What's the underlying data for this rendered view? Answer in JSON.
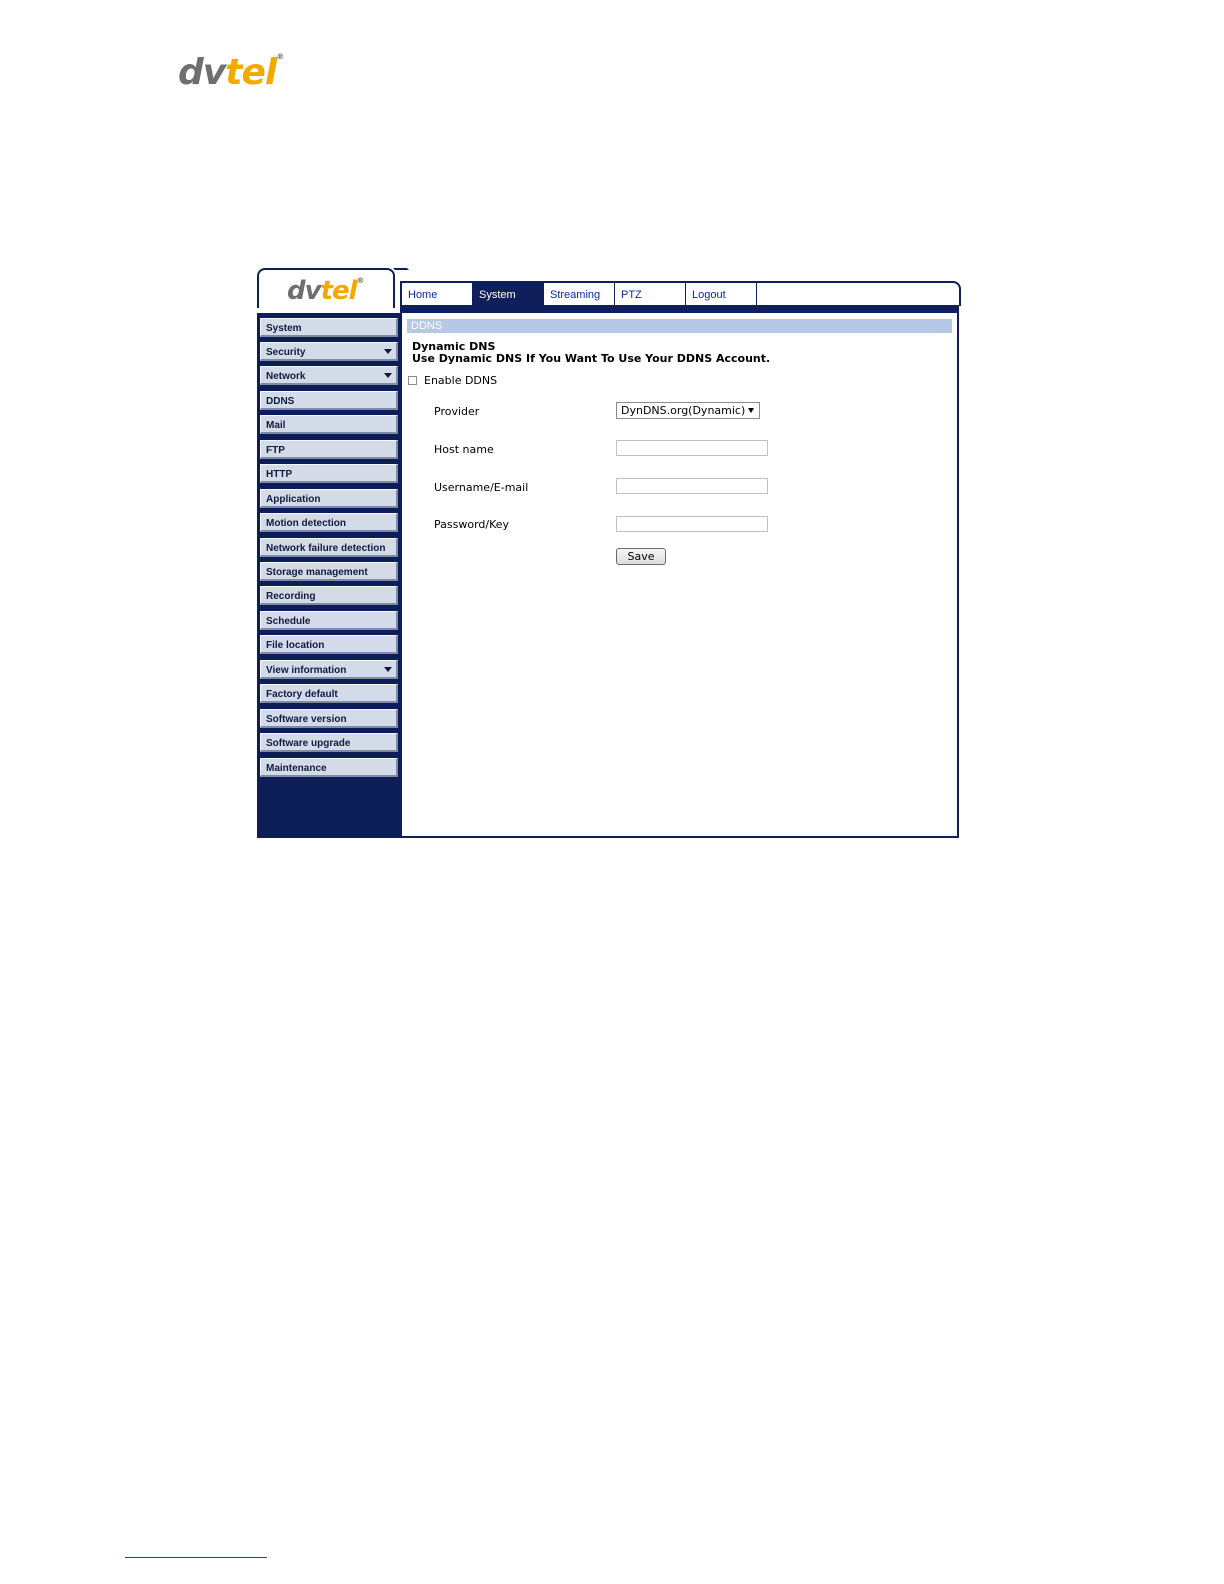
{
  "brand": {
    "logo_dv": "dv",
    "logo_tel": "tel",
    "logo_mark": "®"
  },
  "nav": {
    "tabs": [
      {
        "label": "Home"
      },
      {
        "label": "System"
      },
      {
        "label": "Streaming"
      },
      {
        "label": "PTZ"
      },
      {
        "label": "Logout"
      }
    ],
    "active": "System"
  },
  "sidebar": {
    "items": [
      {
        "label": "System",
        "has_submenu": false
      },
      {
        "label": "Security",
        "has_submenu": true
      },
      {
        "label": "Network",
        "has_submenu": true
      },
      {
        "label": "DDNS",
        "has_submenu": false
      },
      {
        "label": "Mail",
        "has_submenu": false
      },
      {
        "label": "FTP",
        "has_submenu": false
      },
      {
        "label": "HTTP",
        "has_submenu": false
      },
      {
        "label": "Application",
        "has_submenu": false
      },
      {
        "label": "Motion detection",
        "has_submenu": false
      },
      {
        "label": "Network failure detection",
        "has_submenu": false
      },
      {
        "label": "Storage management",
        "has_submenu": false
      },
      {
        "label": "Recording",
        "has_submenu": false
      },
      {
        "label": "Schedule",
        "has_submenu": false
      },
      {
        "label": "File location",
        "has_submenu": false
      },
      {
        "label": "View information",
        "has_submenu": true
      },
      {
        "label": "Factory default",
        "has_submenu": false
      },
      {
        "label": "Software version",
        "has_submenu": false
      },
      {
        "label": "Software upgrade",
        "has_submenu": false
      },
      {
        "label": "Maintenance",
        "has_submenu": false
      }
    ]
  },
  "main": {
    "section_title": "DDNS",
    "description_title": "Dynamic DNS",
    "description_text": "Use Dynamic DNS If You Want To Use Your DDNS Account.",
    "enable_label": "Enable DDNS",
    "enable_checked": false,
    "provider_label": "Provider",
    "provider_value": "DynDNS.org(Dynamic)",
    "host_label": "Host name",
    "host_value": "",
    "username_label": "Username/E-mail",
    "username_value": "",
    "password_label": "Password/Key",
    "password_value": "",
    "save_label": "Save"
  },
  "colors": {
    "navy": "#0f1f5c",
    "sidebar_button": "#d4dbe8",
    "section_bar": "#b5c8e5",
    "logo_gray": "#6f6f6f",
    "logo_orange": "#f2a900"
  }
}
